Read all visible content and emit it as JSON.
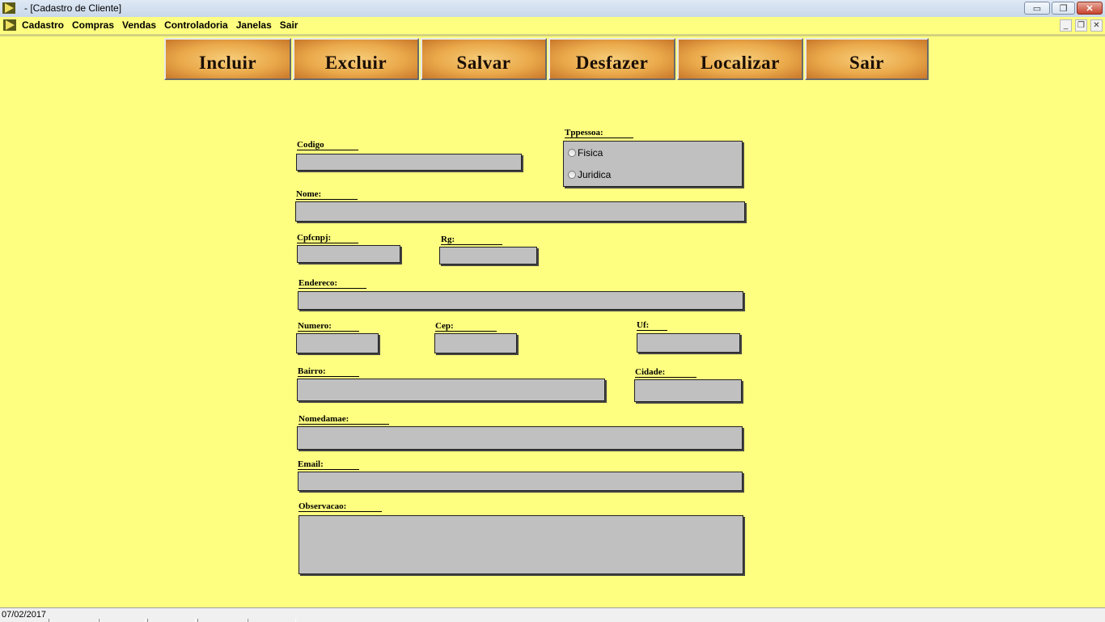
{
  "window": {
    "title": "- [Cadastro de Cliente]",
    "minimize": "▭",
    "restore": "❐",
    "close": "✕"
  },
  "menu": {
    "items": [
      "Cadastro",
      "Compras",
      "Vendas",
      "Controladoria",
      "Janelas",
      "Sair"
    ],
    "mdi_min": "_",
    "mdi_restore": "❐",
    "mdi_close": "✕"
  },
  "toolbar": {
    "incluir": "Incluir",
    "excluir": "Excluir",
    "salvar": "Salvar",
    "desfazer": "Desfazer",
    "localizar": "Localizar",
    "sair": "Sair"
  },
  "form": {
    "codigo": "Codigo",
    "tppessoa": "Tppessoa:",
    "fisica": "Fisica",
    "juridica": "Juridica",
    "nome": "Nome:",
    "cpfcnpj": "Cpfcnpj:",
    "rg": "Rg:",
    "endereco": "Endereco:",
    "numero": "Numero:",
    "cep": "Cep:",
    "uf": "Uf:",
    "bairro": "Bairro:",
    "cidade": "Cidade:",
    "nomedamae": "Nomedamae:",
    "email": "Email:",
    "observacao": "Observacao:"
  },
  "status": {
    "date": "07/02/2017"
  },
  "colors": {
    "background": "#fefe80",
    "field": "#c0c0c0",
    "button": "#eaa94a"
  }
}
